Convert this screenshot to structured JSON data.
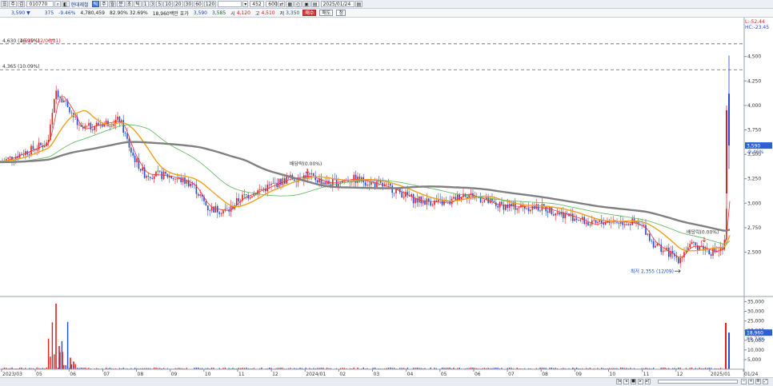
{
  "toolbar": {
    "code": "010770",
    "name": "현대제철",
    "periods": [
      "틱",
      "주",
      "월",
      "분",
      "초",
      "틱"
    ],
    "intervals": [
      "1",
      "3",
      "5",
      "10",
      "20",
      "30",
      "60",
      "120"
    ],
    "count": "452",
    "scale": "600",
    "date": "2025/01/24"
  },
  "quote": {
    "price": "3,590 ▼",
    "change": "375",
    "change_pct": "-9.46%",
    "volume": "4,780,459",
    "vol_ratio": "82.90%",
    "turnover_ratio": "32.69%",
    "trade_amount": "18,960백만",
    "hoga_label": "호가",
    "ask": "3,590",
    "bid": "3,585",
    "open_label": "시",
    "open": "4,120",
    "high_label": "고",
    "high": "4,510",
    "low_label": "저",
    "low": "3,350",
    "buy_label": "매수",
    "sell_label": "매도",
    "extra_label": "정"
  },
  "chart_data": {
    "type": "candlestick",
    "price_axis": {
      "ticks": [
        "4,500",
        "4,250",
        "4,000",
        "3,750",
        "3,500",
        "3,250",
        "3,000",
        "2,750",
        "2,500"
      ],
      "ylim": [
        2300,
        4800
      ]
    },
    "volume_axis": {
      "ticks": [
        "35,000",
        "30,000",
        "25,000",
        "20,000",
        "15,000",
        "10,000",
        "5,000"
      ],
      "ylim": [
        0,
        36000
      ]
    },
    "x_ticks": [
      "2023/03",
      "05",
      "06",
      "07",
      "08",
      "09",
      "10",
      "11",
      "12",
      "2024/01",
      "02",
      "03",
      "04",
      "05",
      "06",
      "07",
      "08",
      "09",
      "10",
      "11",
      "12",
      "2025/01",
      "01/24"
    ],
    "levels": [
      {
        "label": "4,630 (16.95%)",
        "value": 4630
      },
      {
        "label": "4,365 (10.09%)",
        "value": 4365
      }
    ],
    "annotations": [
      {
        "label": "배당락(0.00%)",
        "value": 3290
      },
      {
        "label": "배당락(0.00%)",
        "value": 2590
      },
      {
        "label": "최저 2,355 (12/09)",
        "value": 2355
      }
    ],
    "top_label": "4,510 (12/06/11)",
    "right_labels": [
      "L:-52.44",
      "HC:-23.45"
    ],
    "current_price": {
      "label": "3,590",
      "pct": "-9.46%",
      "value": 3590
    },
    "current_volume": {
      "label": "18,960",
      "pct": "89.73%",
      "value": 18960
    },
    "series": [
      {
        "name": "MA5",
        "color": "#ff3030"
      },
      {
        "name": "MA20",
        "color": "#f0a020"
      },
      {
        "name": "MA60",
        "color": "#5ab55a"
      },
      {
        "name": "MA120",
        "color": "#808080"
      }
    ],
    "grid": false
  },
  "colors": {
    "up": "#e02020",
    "down": "#1f4fd6",
    "level_line": "#666666"
  }
}
